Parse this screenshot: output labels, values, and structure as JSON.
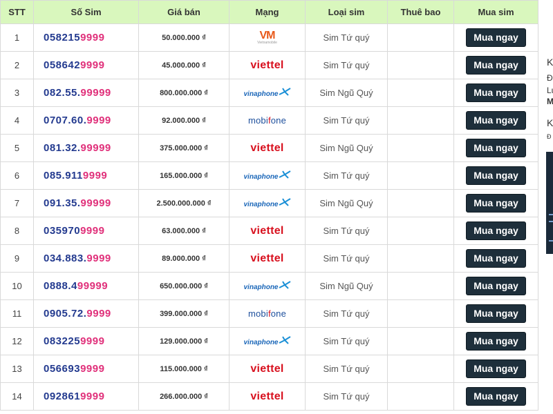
{
  "table": {
    "headers": {
      "stt": "STT",
      "sim": "Số Sim",
      "price": "Giá bán",
      "network": "Mạng",
      "type": "Loại sim",
      "subscription": "Thuê bao",
      "buy": "Mua sim"
    },
    "buy_label": "Mua ngay",
    "rows": [
      {
        "stt": "1",
        "sim_prefix": "058215",
        "sim_suffix": "9999",
        "price": "50.000.000 ₫",
        "network": "Vietnamobile",
        "type": "Sim Tứ quý",
        "subscription": ""
      },
      {
        "stt": "2",
        "sim_prefix": "058642",
        "sim_suffix": "9999",
        "price": "45.000.000 ₫",
        "network": "Viettel",
        "type": "Sim Tứ quý",
        "subscription": ""
      },
      {
        "stt": "3",
        "sim_prefix": "082.55.",
        "sim_suffix": "99999",
        "price": "800.000.000 ₫",
        "network": "Vinaphone",
        "type": "Sim Ngũ Quý",
        "subscription": ""
      },
      {
        "stt": "4",
        "sim_prefix": "0707.60.",
        "sim_suffix": "9999",
        "price": "92.000.000 ₫",
        "network": "Mobifone",
        "type": "Sim Tứ quý",
        "subscription": ""
      },
      {
        "stt": "5",
        "sim_prefix": "081.32.",
        "sim_suffix": "99999",
        "price": "375.000.000 ₫",
        "network": "Viettel",
        "type": "Sim Ngũ Quý",
        "subscription": ""
      },
      {
        "stt": "6",
        "sim_prefix": "085.911",
        "sim_suffix": "9999",
        "price": "165.000.000 ₫",
        "network": "Vinaphone",
        "type": "Sim Tứ quý",
        "subscription": ""
      },
      {
        "stt": "7",
        "sim_prefix": "091.35.",
        "sim_suffix": "99999",
        "price": "2.500.000.000 ₫",
        "network": "Vinaphone",
        "type": "Sim Ngũ Quý",
        "subscription": ""
      },
      {
        "stt": "8",
        "sim_prefix": "035970",
        "sim_suffix": "9999",
        "price": "63.000.000 ₫",
        "network": "Viettel",
        "type": "Sim Tứ quý",
        "subscription": ""
      },
      {
        "stt": "9",
        "sim_prefix": "034.883.",
        "sim_suffix": "9999",
        "price": "89.000.000 ₫",
        "network": "Viettel",
        "type": "Sim Tứ quý",
        "subscription": ""
      },
      {
        "stt": "10",
        "sim_prefix": "0888.4",
        "sim_suffix": "99999",
        "price": "650.000.000 ₫",
        "network": "Vinaphone",
        "type": "Sim Ngũ Quý",
        "subscription": ""
      },
      {
        "stt": "11",
        "sim_prefix": "0905.72.",
        "sim_suffix": "9999",
        "price": "399.000.000 ₫",
        "network": "Mobifone",
        "type": "Sim Tứ quý",
        "subscription": ""
      },
      {
        "stt": "12",
        "sim_prefix": "083225",
        "sim_suffix": "9999",
        "price": "129.000.000 ₫",
        "network": "Vinaphone",
        "type": "Sim Tứ quý",
        "subscription": ""
      },
      {
        "stt": "13",
        "sim_prefix": "056693",
        "sim_suffix": "9999",
        "price": "115.000.000 ₫",
        "network": "Viettel",
        "type": "Sim Tứ quý",
        "subscription": ""
      },
      {
        "stt": "14",
        "sim_prefix": "092861",
        "sim_suffix": "9999",
        "price": "266.000.000 ₫",
        "network": "Viettel",
        "type": "Sim Tứ quý",
        "subscription": ""
      }
    ]
  },
  "logos": {
    "vietnamobile_mark": "VM",
    "vietnamobile_sub": "Vietnamobile",
    "viettel": "viettel",
    "vinaphone": "vinaphone",
    "mobi_a": "mobi",
    "mobi_b": "f",
    "mobi_c": "one"
  },
  "sidebar": {
    "fragments": [
      "K",
      "Đ",
      "Lu",
      "M",
      "K",
      "Đ"
    ]
  },
  "colors": {
    "header_bg": "#d9f7bd",
    "sim_prefix": "#233a8f",
    "sim_suffix": "#e0307a",
    "button_bg": "#1e2f3b",
    "viettel_red": "#d8101e",
    "vinaphone_blue": "#1a66b8"
  }
}
